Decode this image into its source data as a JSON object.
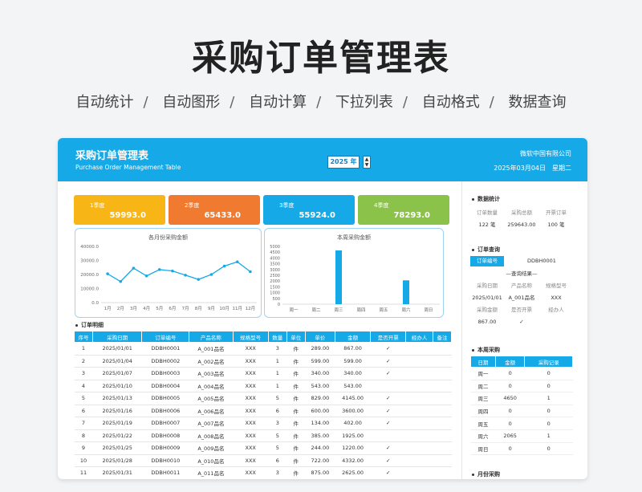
{
  "hero": {
    "title": "采购订单管理表",
    "features": [
      "自动统计",
      "自动图形",
      "自动计算",
      "下拉列表",
      "自动格式",
      "数据查询"
    ]
  },
  "header": {
    "title": "采购订单管理表",
    "subtitle": "Purchase Order Management Table",
    "year": "2025 年",
    "company": "微软中国有限公司",
    "date": "2025年03月04日",
    "weekday": "星期二"
  },
  "kpis": [
    {
      "label": "1季度",
      "value": "59993.0",
      "color": "#f8b616"
    },
    {
      "label": "2季度",
      "value": "65433.0",
      "color": "#ef7a30"
    },
    {
      "label": "3季度",
      "value": "55924.0",
      "color": "#16a9e8"
    },
    {
      "label": "4季度",
      "value": "78293.0",
      "color": "#8bc34a"
    }
  ],
  "chart_data": [
    {
      "type": "line",
      "title": "各月份采购金额",
      "categories": [
        "1月",
        "2月",
        "3月",
        "4月",
        "5月",
        "6月",
        "7月",
        "8月",
        "9月",
        "10月",
        "11月",
        "12月"
      ],
      "series": [
        {
          "values": [
            20500,
            15000,
            24500,
            19000,
            23500,
            22500,
            19500,
            16500,
            20000,
            26000,
            29000,
            22000
          ]
        }
      ],
      "ylim": [
        0,
        40000
      ],
      "yticks": [
        "0.0",
        "10000.0",
        "20000.0",
        "30000.0",
        "40000.0"
      ],
      "color": "#16a9e8"
    },
    {
      "type": "bar",
      "title": "本周采购金额",
      "categories": [
        "周一",
        "周二",
        "周三",
        "周四",
        "周五",
        "周六",
        "周日"
      ],
      "values": [
        0,
        0,
        4650,
        0,
        0,
        2065,
        0
      ],
      "ylim": [
        0,
        5000
      ],
      "yticks": [
        "0",
        "500",
        "1000",
        "1500",
        "2000",
        "2500",
        "3000",
        "3500",
        "4000",
        "4500",
        "5000"
      ],
      "color": "#16a9e8"
    }
  ],
  "orders": {
    "section": "订单明细",
    "columns": [
      "序号",
      "采购日期",
      "订单编号",
      "产品名称",
      "规格型号",
      "数量",
      "单位",
      "单价",
      "金额",
      "是否开票",
      "经办人",
      "备注"
    ],
    "rows": [
      [
        "1",
        "2025/01/01",
        "DDBH0001",
        "A_001品名",
        "XXX",
        "3",
        "件",
        "289.00",
        "867.00",
        "✓",
        "",
        ""
      ],
      [
        "2",
        "2025/01/04",
        "DDBH0002",
        "A_002品名",
        "XXX",
        "1",
        "件",
        "599.00",
        "599.00",
        "✓",
        "",
        ""
      ],
      [
        "3",
        "2025/01/07",
        "DDBH0003",
        "A_003品名",
        "XXX",
        "1",
        "件",
        "340.00",
        "340.00",
        "✓",
        "",
        ""
      ],
      [
        "4",
        "2025/01/10",
        "DDBH0004",
        "A_004品名",
        "XXX",
        "1",
        "件",
        "543.00",
        "543.00",
        "",
        "",
        ""
      ],
      [
        "5",
        "2025/01/13",
        "DDBH0005",
        "A_005品名",
        "XXX",
        "5",
        "件",
        "829.00",
        "4145.00",
        "✓",
        "",
        ""
      ],
      [
        "6",
        "2025/01/16",
        "DDBH0006",
        "A_006品名",
        "XXX",
        "6",
        "件",
        "600.00",
        "3600.00",
        "✓",
        "",
        ""
      ],
      [
        "7",
        "2025/01/19",
        "DDBH0007",
        "A_007品名",
        "XXX",
        "3",
        "件",
        "134.00",
        "402.00",
        "✓",
        "",
        ""
      ],
      [
        "8",
        "2025/01/22",
        "DDBH0008",
        "A_008品名",
        "XXX",
        "5",
        "件",
        "385.00",
        "1925.00",
        "",
        "",
        ""
      ],
      [
        "9",
        "2025/01/25",
        "DDBH0009",
        "A_009品名",
        "XXX",
        "5",
        "件",
        "244.00",
        "1220.00",
        "✓",
        "",
        ""
      ],
      [
        "10",
        "2025/01/28",
        "DDBH0010",
        "A_010品名",
        "XXX",
        "6",
        "件",
        "722.00",
        "4332.00",
        "✓",
        "",
        ""
      ],
      [
        "11",
        "2025/01/31",
        "DDBH0011",
        "A_011品名",
        "XXX",
        "3",
        "件",
        "875.00",
        "2625.00",
        "✓",
        "",
        ""
      ]
    ]
  },
  "stats": {
    "section": "数据统计",
    "labels": [
      "订单数量",
      "采购总额",
      "开票订单"
    ],
    "values": [
      "122 笔",
      "259643.00",
      "100 笔"
    ]
  },
  "lookup": {
    "section": "订单查询",
    "tag": "订单编号",
    "order_no": "DDBH0001",
    "result_title": "—查询结果—",
    "labels1": [
      "采购日期",
      "产品名称",
      "规格型号"
    ],
    "values1": [
      "2025/01/01",
      "A_001品名",
      "XXX"
    ],
    "labels2": [
      "采购金额",
      "是否开票",
      "经办人"
    ],
    "values2": [
      "867.00",
      "✓",
      ""
    ]
  },
  "weekly": {
    "section": "本周采购",
    "columns": [
      "日期",
      "金额",
      "采购记录"
    ],
    "rows": [
      [
        "周一",
        "0",
        "0"
      ],
      [
        "周二",
        "0",
        "0"
      ],
      [
        "周三",
        "4650",
        "1"
      ],
      [
        "周四",
        "0",
        "0"
      ],
      [
        "周五",
        "0",
        "0"
      ],
      [
        "周六",
        "2065",
        "1"
      ],
      [
        "周日",
        "0",
        "0"
      ]
    ]
  },
  "monthly": {
    "section": "月份采购"
  }
}
